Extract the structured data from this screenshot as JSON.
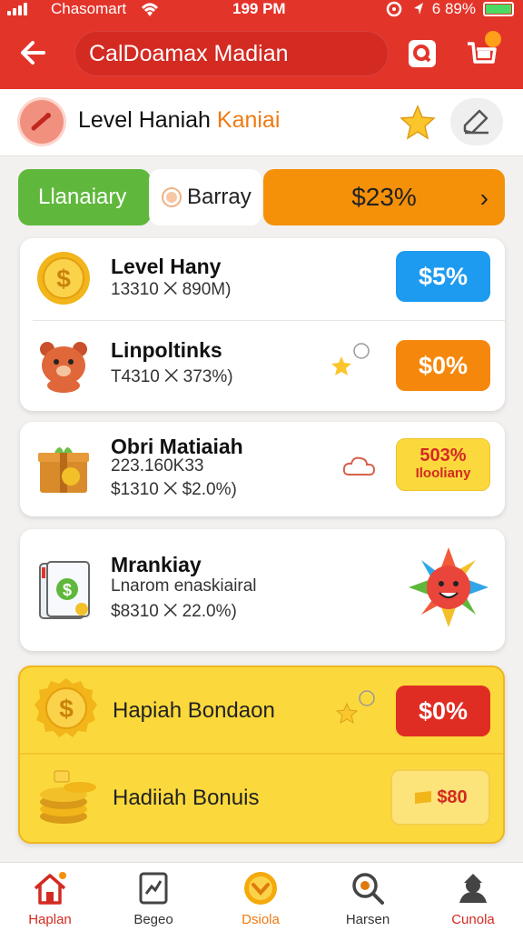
{
  "status": {
    "carrier": "Chasomart",
    "time": "199 PM",
    "battery": "6 89%"
  },
  "header": {
    "search_placeholder": "CalDoamax Madian"
  },
  "level": {
    "title_main": "Level Haniah",
    "title_highlight": "Kaniai"
  },
  "tabs": [
    {
      "label": "Llanaiary"
    },
    {
      "label": "Barray"
    },
    {
      "label": "$23%"
    }
  ],
  "cards": [
    {
      "title": "Level Hany",
      "sub": "13310 ⨉ 890M)",
      "badge": "$5%",
      "badge_color": "#1d9bf0",
      "icon": "gold-coin-icon"
    },
    {
      "title": "Linpoltinks",
      "sub": "T4310 ⨉ 373%)",
      "badge": "$0%",
      "badge_color": "#f5880c",
      "icon": "bear-icon"
    },
    {
      "title": "Obri Matiaiah",
      "sub1": "223.160K33",
      "sub2": "$1310 ⨉ $2.0%)",
      "badge_line1": "503%",
      "badge_line2": "Ilooliany",
      "badge_color": "#fbd93c",
      "icon": "gift-box-icon"
    },
    {
      "title": "Mrankiay",
      "sub1": "Lnarom enaskiairal",
      "sub2": "$8310 ⨉ 22.0%)",
      "icon": "coupon-book-icon"
    }
  ],
  "bonus": [
    {
      "title": "Hapiah Bondaon",
      "badge": "$0%",
      "badge_color": "#e02d24",
      "icon": "gold-coin-icon"
    },
    {
      "title": "Hadiiah Bonuis",
      "badge": "$80",
      "icon": "coin-stack-icon"
    }
  ],
  "nav": [
    {
      "label": "Haplan",
      "icon": "home-icon"
    },
    {
      "label": "Begeo",
      "icon": "document-icon"
    },
    {
      "label": "Dsiola",
      "icon": "chevron-circle-icon"
    },
    {
      "label": "Harsen",
      "icon": "magnifier-icon"
    },
    {
      "label": "Cunola",
      "icon": "user-icon"
    }
  ],
  "colors": {
    "brand": "#e3342a",
    "accent_orange": "#f59009",
    "accent_green": "#5fb83c",
    "bonus_yellow": "#fbd93c"
  }
}
